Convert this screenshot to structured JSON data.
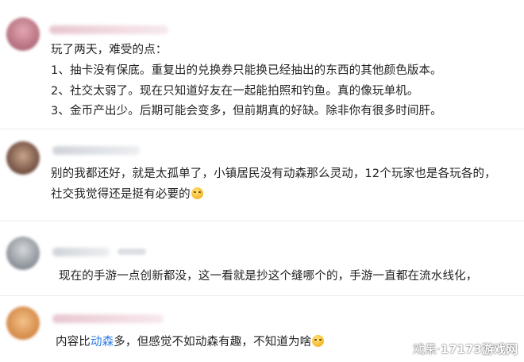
{
  "comments": [
    {
      "lines": [
        "玩了两天，难受的点：",
        "1、抽卡没有保底。重复出的兑换券只能换已经抽出的东西的其他颜色版本。",
        "2、社交太弱了。现在只知道好友在一起能拍照和钓鱼。真的像玩单机。",
        "3、金币产出少。后期可能会变多，但前期真的好缺。除非你有很多时间肝。"
      ]
    },
    {
      "lines": [
        "别的我都还好，就是太孤单了，小镇居民没有动森那么灵动，12个玩家也是各玩各的，",
        "社交我觉得还是挺有必要的"
      ],
      "emoji": "sweat-smile-emoji"
    },
    {
      "lines": [
        "现在的手游一点创新都没，这一看就是抄这个缝哪个的，手游一直都在流水线化，"
      ]
    },
    {
      "prefix": "内容比",
      "highlight": "动森",
      "suffix": "多，但感觉不如动森有趣，不知道为啥",
      "highlight_color": "#2f7be6",
      "emoji": "sweat-smile-emoji"
    }
  ],
  "watermark": {
    "left": "戏呆·",
    "right": "17173游戏网"
  }
}
